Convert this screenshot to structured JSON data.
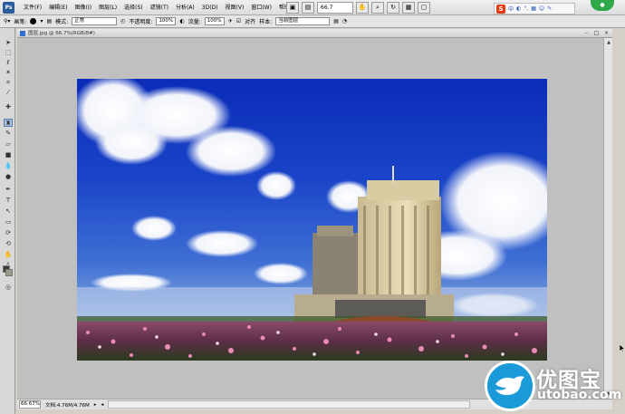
{
  "app": {
    "logo_text": "Ps"
  },
  "menu": [
    "文件(F)",
    "编辑(E)",
    "图像(I)",
    "图层(L)",
    "选择(S)",
    "滤镜(T)",
    "分析(A)",
    "3D(D)",
    "视图(V)",
    "窗口(W)",
    "帮助(H)"
  ],
  "menubar_tools": {
    "zoom_value": "66.7"
  },
  "ime": {
    "brand_glyph": "S",
    "label": "中"
  },
  "options": {
    "brush_label": "画笔:",
    "mode_label": "模式:",
    "mode_value": "正常",
    "opacity_label": "不透明度:",
    "opacity_value": "100%",
    "flow_label": "流量:",
    "flow_value": "100%",
    "align_label": "对齐",
    "sample_label": "样本:",
    "sample_value": "当前图层"
  },
  "document": {
    "title": "图层.jpg @ 66.7%(RGB/8#)",
    "zoom_value": "66.67%",
    "doc_info": "文档:4.76M/4.76M"
  },
  "watermark": {
    "chinese": "优图宝",
    "url": "utobao.com"
  },
  "colors": {
    "foreground": "#3d3d38",
    "background": "#9d9b89",
    "accent": "#2c5d9a"
  },
  "icons": {
    "tools": [
      "move-icon",
      "marquee-icon",
      "lasso-icon",
      "magic-wand-icon",
      "crop-icon",
      "eyedropper-icon",
      "healing-brush-icon",
      "clone-stamp-icon",
      "history-brush-icon",
      "eraser-icon",
      "gradient-icon",
      "blur-icon",
      "dodge-icon",
      "pen-icon",
      "type-icon",
      "path-select-icon",
      "shape-icon",
      "3d-rotate-icon",
      "3d-camera-icon",
      "hand-icon",
      "zoom-icon"
    ]
  }
}
